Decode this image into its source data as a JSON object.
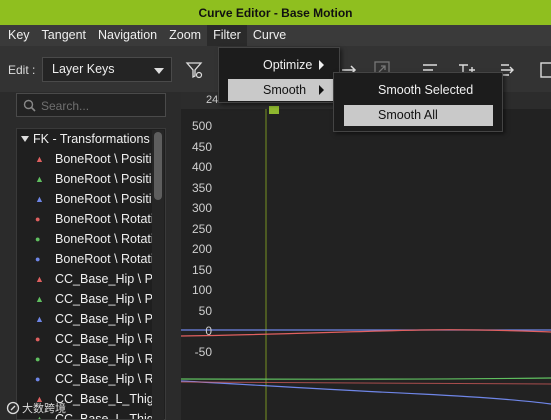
{
  "window": {
    "title": "Curve Editor - Base Motion"
  },
  "menu": [
    "Key",
    "Tangent",
    "Navigation",
    "Zoom",
    "Filter",
    "Curve"
  ],
  "toolbar": {
    "edit_label": "Edit :",
    "edit_combo_value": "Layer Keys"
  },
  "search": {
    "placeholder": "Search..."
  },
  "tree": {
    "header": "FK - Transformations",
    "rows": [
      {
        "label": "BoneRoot \\ Positi",
        "marker": "triangle",
        "color": "#e06060"
      },
      {
        "label": "BoneRoot \\ Positi",
        "marker": "triangle",
        "color": "#60c060"
      },
      {
        "label": "BoneRoot \\ Positi",
        "marker": "triangle",
        "color": "#6f86e8"
      },
      {
        "label": "BoneRoot \\ Rotati",
        "marker": "circle",
        "color": "#e06060"
      },
      {
        "label": "BoneRoot \\ Rotati",
        "marker": "circle",
        "color": "#60c060"
      },
      {
        "label": "BoneRoot \\ Rotati",
        "marker": "circle",
        "color": "#6f86e8"
      },
      {
        "label": "CC_Base_Hip \\ P",
        "marker": "triangle",
        "color": "#e06060"
      },
      {
        "label": "CC_Base_Hip \\ P",
        "marker": "triangle",
        "color": "#60c060"
      },
      {
        "label": "CC_Base_Hip \\ P",
        "marker": "triangle",
        "color": "#6f86e8"
      },
      {
        "label": "CC_Base_Hip \\ R",
        "marker": "circle",
        "color": "#e06060"
      },
      {
        "label": "CC_Base_Hip \\ R",
        "marker": "circle",
        "color": "#60c060"
      },
      {
        "label": "CC_Base_Hip \\ R",
        "marker": "circle",
        "color": "#6f86e8"
      },
      {
        "label": "CC_Base_L_Thig",
        "marker": "triangle",
        "color": "#e06060"
      },
      {
        "label": "CC_Base_L_Thig",
        "marker": "triangle",
        "color": "#60c060"
      }
    ]
  },
  "graph": {
    "ruler_labels": [
      "24"
    ],
    "y_ticks": [
      "500",
      "450",
      "400",
      "350",
      "300",
      "250",
      "200",
      "150",
      "100",
      "50",
      "0",
      "-50"
    ],
    "colors": {
      "red": "#e06060",
      "green": "#60c060",
      "blue": "#6f86e8",
      "playhead": "#8fb82f"
    }
  },
  "filter_menu": {
    "items": [
      "Optimize",
      "Smooth"
    ]
  },
  "smooth_submenu": {
    "items": [
      "Smooth Selected",
      "Smooth All"
    ]
  },
  "watermark": "大数跨境"
}
